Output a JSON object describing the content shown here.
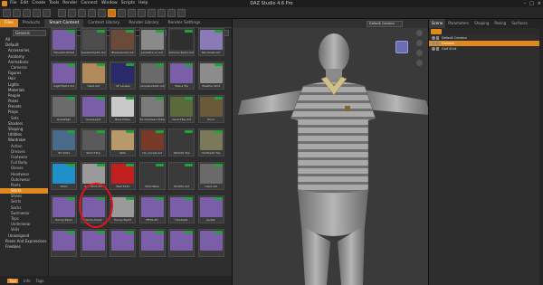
{
  "window": {
    "title": "DAZ Studio 4.6 Pro",
    "menu": [
      "File",
      "Edit",
      "Create",
      "Tools",
      "Render",
      "Connect",
      "Window",
      "Scripts",
      "Help"
    ],
    "controls": [
      "–",
      "□",
      "×"
    ]
  },
  "library": {
    "tabs": [
      "Smart Content",
      "Content Library",
      "Render Library",
      "Render Settings"
    ],
    "side_tab": "Files",
    "products_tab": "Products",
    "dropdown_value": "Genesis",
    "pages": "1 - 250",
    "store_button": "DAZ 3D Store",
    "tree": [
      {
        "label": "All",
        "level": 1
      },
      {
        "label": "Default",
        "level": 1
      },
      {
        "label": "Accessories",
        "level": 2
      },
      {
        "label": "Anatomy",
        "level": 2
      },
      {
        "label": "Animations",
        "level": 2
      },
      {
        "label": "Cameras",
        "level": 3
      },
      {
        "label": "Figures",
        "level": 2
      },
      {
        "label": "Hair",
        "level": 2
      },
      {
        "label": "Lights",
        "level": 2
      },
      {
        "label": "Materials",
        "level": 2
      },
      {
        "label": "People",
        "level": 2
      },
      {
        "label": "Poses",
        "level": 2
      },
      {
        "label": "Presets",
        "level": 2
      },
      {
        "label": "Props",
        "level": 2
      },
      {
        "label": "Sets",
        "level": 3
      },
      {
        "label": "Shaders",
        "level": 2
      },
      {
        "label": "Shaping",
        "level": 2
      },
      {
        "label": "Utilities",
        "level": 2
      },
      {
        "label": "Wardrobe",
        "level": 2
      },
      {
        "label": "Action",
        "level": 3
      },
      {
        "label": "Dresses",
        "level": 3
      },
      {
        "label": "Footwear",
        "level": 3
      },
      {
        "label": "Full Body",
        "level": 3
      },
      {
        "label": "Gloves",
        "level": 3
      },
      {
        "label": "Headwear",
        "level": 3
      },
      {
        "label": "Outerwear",
        "level": 3
      },
      {
        "label": "Pants",
        "level": 3
      },
      {
        "label": "Shirts",
        "level": 3,
        "selected": true
      },
      {
        "label": "Shoes",
        "level": 3
      },
      {
        "label": "Skirts",
        "level": 3
      },
      {
        "label": "Socks",
        "level": 3
      },
      {
        "label": "Swimwear",
        "level": 3
      },
      {
        "label": "Tops",
        "level": 3
      },
      {
        "label": "Underwear",
        "level": 3
      },
      {
        "label": "Veils",
        "level": 3
      },
      {
        "label": "Unassigned",
        "level": 2
      },
      {
        "label": "Poses And Expressions",
        "level": 1
      },
      {
        "label": "Freebies",
        "level": 1
      }
    ],
    "thumb_colors": [
      "#7a5ea8",
      "#4d4d4d",
      "#6b4a3a",
      "#8a8a8a",
      "#2f2f2f",
      "#8b7ab8",
      "#7a5ea8",
      "#b08a5a",
      "#2a2a6a",
      "#6a6a6a",
      "#7a5ea8",
      "#8c8c8c",
      "#6b6b6b",
      "#7a5ea8",
      "#c9c9c9",
      "#7a7a7a",
      "#5a6a3a",
      "#6a5a3a",
      "#4a6a8a",
      "#5a5a5a",
      "#b89a6a",
      "#7a3a2a",
      "#3a3a3a",
      "#7a7a5a",
      "#1f90c8",
      "#9a9a9a",
      "#c22020",
      "#3a3a3a",
      "#3a3a3a",
      "#6a6a6a",
      "#7a5ea8",
      "#7a5ea8",
      "#9a9a9a",
      "#7a5ea8",
      "#7a5ea8",
      "#7a5ea8",
      "#7a5ea8",
      "#7a5ea8",
      "#7a5ea8",
      "#7a5ea8",
      "#7a5ea8",
      "#7a5ea8"
    ],
    "thumb_labels": [
      "!StreetClothSet",
      "SweeterTop01.duf",
      "BlazerJacket.duf",
      "Jacket01-x1.duf",
      "Kimono-Top01.duf",
      "Silk-Chest.duf",
      "!LightTop01.duf",
      "!Vest.duf",
      "!LF Lenses",
      "Lampshade01.duf",
      "!Mane Top",
      "!Feather Shirt",
      "GrassHigh",
      "GrassLight",
      "Boss Pillow",
      "Enchantress Shawl",
      "!GuardTop.duf",
      "!Tunic",
      "!Pri Sh01",
      "Shirt-T-Top",
      "SDD",
      "!VL_Corset.duf",
      "!Shirt01 Top",
      "!OldTop01 Top",
      "!Shirt",
      "Golf Shirt.duf",
      "!Red Shirt",
      "Shirt-WGA",
      "Shirt02.duf",
      "!Vest.duf",
      "Handy-Top01",
      "Handy-Top02",
      "Handy-Top03",
      "MFSS-3D",
      "Hoodie01",
      "Jacket",
      "",
      "",
      "",
      "",
      "",
      ""
    ],
    "bottom_tabs": [
      "Tips",
      "Info",
      "Tags"
    ]
  },
  "viewport": {
    "camera": "Default Camera"
  },
  "scene": {
    "tabs": [
      "Scene",
      "Parameters",
      "Shaping",
      "Posing",
      "Surfaces"
    ],
    "rows": [
      {
        "label": "Default Camera"
      },
      {
        "label": "Genesis",
        "selected": true
      },
      {
        "label": "Golf Shirt"
      }
    ]
  }
}
